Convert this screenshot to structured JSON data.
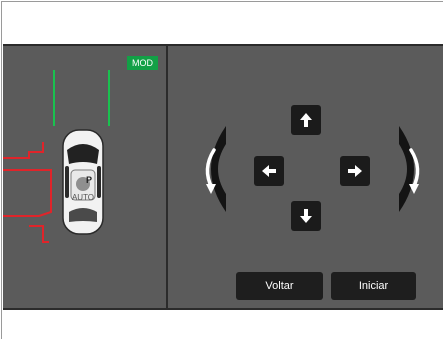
{
  "badge": {
    "mod": "MOD"
  },
  "car": {
    "mode_label": "AUTO",
    "icon_letter": "P"
  },
  "controls": {
    "up": "arrow-up",
    "down": "arrow-down",
    "left": "arrow-left",
    "right": "arrow-right",
    "rotate_left": "rotate-ccw",
    "rotate_right": "rotate-cw"
  },
  "buttons": {
    "back": "Voltar",
    "start": "Iniciar"
  },
  "colors": {
    "background": "#5b5b5b",
    "guide_green": "#19c24f",
    "guide_red": "#e0242a",
    "badge_green": "#12a046",
    "button_dark": "#1b1b1b"
  }
}
